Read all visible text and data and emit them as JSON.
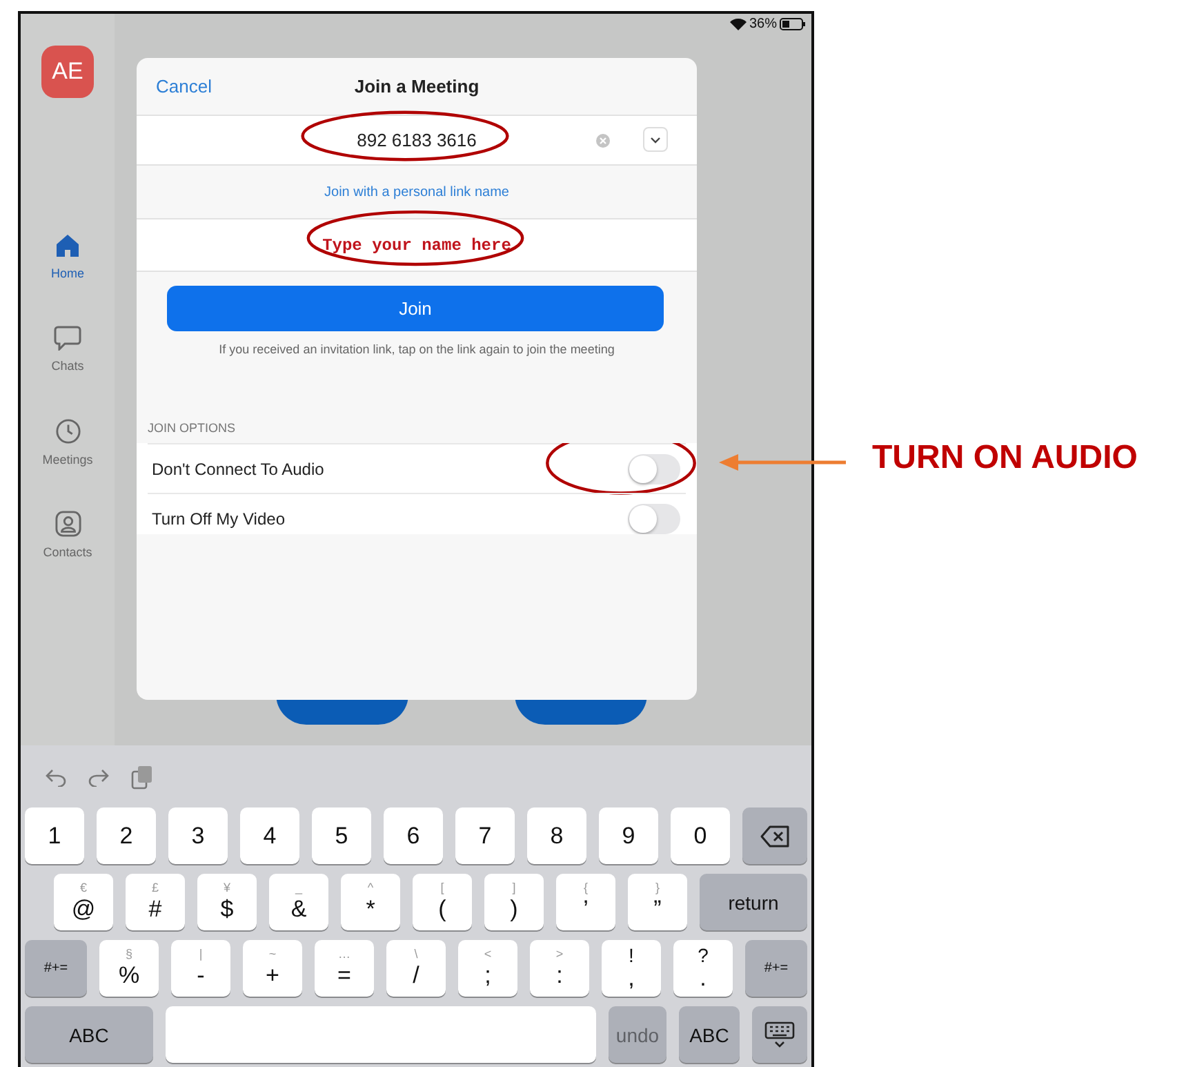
{
  "status_bar": {
    "battery": "36%"
  },
  "sidebar": {
    "avatar": "AE",
    "items": [
      {
        "label": "Home",
        "kind": "home",
        "selected": true
      },
      {
        "label": "Chats",
        "kind": "chat",
        "selected": false
      },
      {
        "label": "Meetings",
        "kind": "clock",
        "selected": false
      },
      {
        "label": "Contacts",
        "kind": "contact",
        "selected": false
      }
    ]
  },
  "dialog": {
    "cancel": "Cancel",
    "title": "Join a Meeting",
    "meeting_id": {
      "value": "892 6183 3616",
      "circled": true
    },
    "personal_link": "Join with a personal link name",
    "name_field": {
      "placeholder": "Type your name here",
      "circled": true
    },
    "join_button": "Join",
    "hint": "If you received an invitation link, tap on the link again to join the meeting",
    "options_heading": "JOIN OPTIONS",
    "options": [
      {
        "label": "Don't Connect To Audio",
        "on": false,
        "circled": true
      },
      {
        "label": "Turn Off My Video",
        "on": false
      }
    ]
  },
  "keyboard": {
    "number_row": [
      {
        "kind": "char",
        "label": "1"
      },
      {
        "kind": "char",
        "label": "2"
      },
      {
        "kind": "char",
        "label": "3"
      },
      {
        "kind": "char",
        "label": "4"
      },
      {
        "kind": "char",
        "label": "5"
      },
      {
        "kind": "char",
        "label": "6"
      },
      {
        "kind": "char",
        "label": "7"
      },
      {
        "kind": "char",
        "label": "8"
      },
      {
        "kind": "char",
        "label": "9"
      },
      {
        "kind": "char",
        "label": "0"
      },
      {
        "kind": "backspace"
      }
    ],
    "symbol_row": [
      {
        "kind": "char",
        "sub": "€",
        "label": "@"
      },
      {
        "kind": "char",
        "sub": "£",
        "label": "#"
      },
      {
        "kind": "char",
        "sub": "¥",
        "label": "$"
      },
      {
        "kind": "char",
        "sub": "_",
        "label": "&"
      },
      {
        "kind": "char",
        "sub": "^",
        "label": "*"
      },
      {
        "kind": "char",
        "sub": "[",
        "label": "("
      },
      {
        "kind": "char",
        "sub": "]",
        "label": ")"
      },
      {
        "kind": "char",
        "sub": "{",
        "label": "’"
      },
      {
        "kind": "char",
        "sub": "}",
        "label": "”"
      },
      {
        "kind": "function",
        "label": "return"
      }
    ],
    "punctuation_row": [
      {
        "kind": "function",
        "label": "#+="
      },
      {
        "kind": "char",
        "sub": "§",
        "label": "%"
      },
      {
        "kind": "char",
        "sub": "|",
        "label": "-"
      },
      {
        "kind": "char",
        "sub": "~",
        "label": "+"
      },
      {
        "kind": "char",
        "sub": "…",
        "label": "="
      },
      {
        "kind": "char",
        "sub": "\\",
        "label": "/"
      },
      {
        "kind": "char",
        "sub": "<",
        "label": ";"
      },
      {
        "kind": "char",
        "sub": ">",
        "label": ":"
      },
      {
        "kind": "dual",
        "sub": "!",
        "label": ","
      },
      {
        "kind": "dual",
        "sub": "?",
        "label": "."
      },
      {
        "kind": "function",
        "label": "#+="
      }
    ],
    "bottom_row": [
      {
        "kind": "function",
        "label": "ABC",
        "disabled": false
      },
      {
        "kind": "space",
        "disabled": false
      },
      {
        "kind": "function",
        "label": "undo",
        "disabled": true
      },
      {
        "kind": "function",
        "label": "ABC",
        "disabled": false
      },
      {
        "kind": "hide",
        "disabled": false
      }
    ]
  },
  "callout": {
    "text": "TURN ON AUDIO"
  }
}
